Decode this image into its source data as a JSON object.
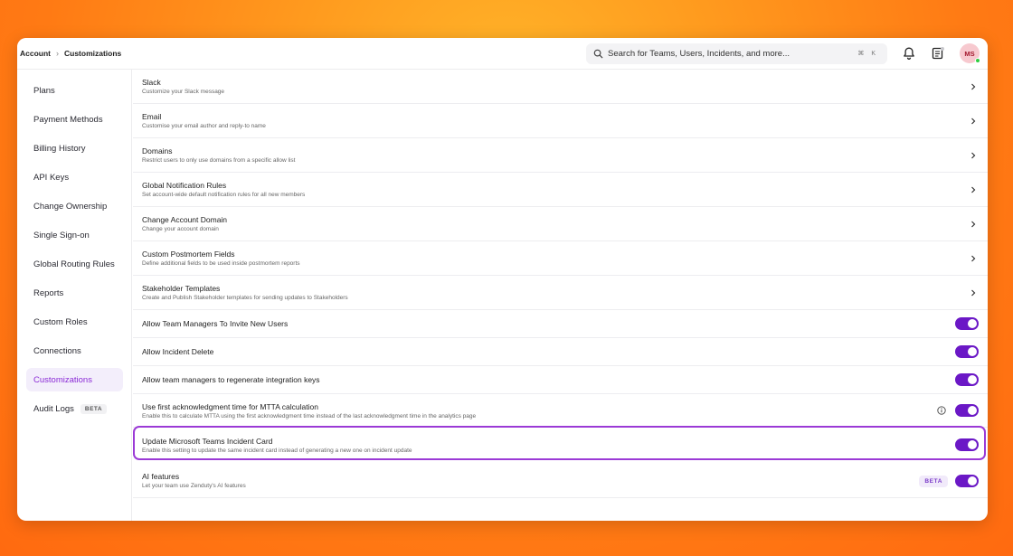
{
  "breadcrumb": {
    "root": "Account",
    "current": "Customizations"
  },
  "search": {
    "placeholder": "Search for Teams, Users, Incidents, and more...",
    "shortcut": "⌘ K"
  },
  "user": {
    "initials": "MS"
  },
  "sidebar": {
    "items": [
      {
        "label": "Plans"
      },
      {
        "label": "Payment Methods"
      },
      {
        "label": "Billing History"
      },
      {
        "label": "API Keys"
      },
      {
        "label": "Change Ownership"
      },
      {
        "label": "Single Sign-on"
      },
      {
        "label": "Global Routing Rules"
      },
      {
        "label": "Reports"
      },
      {
        "label": "Custom Roles"
      },
      {
        "label": "Connections"
      },
      {
        "label": "Customizations",
        "active": true
      },
      {
        "label": "Audit Logs",
        "badge": "BETA"
      }
    ]
  },
  "settings": {
    "links": [
      {
        "title": "Slack",
        "desc": "Customize your Slack message"
      },
      {
        "title": "Email",
        "desc": "Customise your email author and reply-to name"
      },
      {
        "title": "Domains",
        "desc": "Restrict users to only use domains from a specific allow list"
      },
      {
        "title": "Global Notification Rules",
        "desc": "Set account-wide default notification rules for all new members"
      },
      {
        "title": "Change Account Domain",
        "desc": "Change your account domain"
      },
      {
        "title": "Custom Postmortem Fields",
        "desc": "Define additional fields to be used inside postmortem reports"
      },
      {
        "title": "Stakeholder Templates",
        "desc": "Create and Publish Stakeholder templates for sending updates to Stakeholders"
      }
    ],
    "toggles": [
      {
        "title": "Allow Team Managers To Invite New Users",
        "enabled": true
      },
      {
        "title": "Allow Incident Delete",
        "enabled": true
      },
      {
        "title": "Allow team managers to regenerate integration keys",
        "enabled": true
      },
      {
        "title": "Use first acknowledgment time for MTTA calculation",
        "desc": "Enable this to calculate MTTA using the first acknowledgment time instead of the last acknowledgment time in the analytics page",
        "enabled": true
      },
      {
        "title": "Update Microsoft Teams Incident Card",
        "desc": "Enable this setting to update the same incident card instead of generating a new one on incident update",
        "enabled": true
      },
      {
        "title": "AI features",
        "desc": "Let your team use Zenduty's AI features",
        "badge": "BETA",
        "enabled": true
      }
    ]
  },
  "colors": {
    "accent": "#6b18c6",
    "highlight": "#9b3ad6",
    "active_bg": "#f3eefb"
  }
}
